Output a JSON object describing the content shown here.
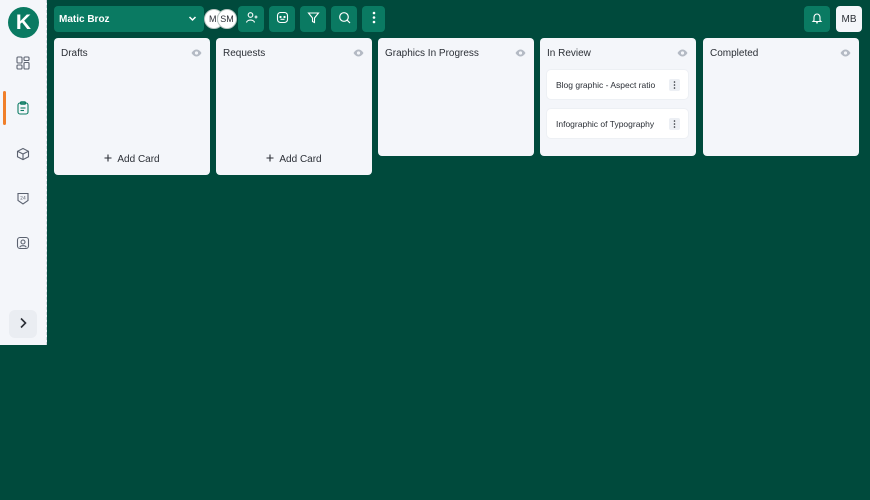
{
  "app": {
    "logo_letter": "K",
    "brand_color": "#0a7a62",
    "accent_color": "#f07f2a"
  },
  "sidebar": {
    "items": [
      {
        "icon": "dashboard-icon",
        "active": false
      },
      {
        "icon": "clipboard-icon",
        "active": true
      },
      {
        "icon": "cube-icon",
        "active": false
      },
      {
        "icon": "calendar-24-icon",
        "active": false
      },
      {
        "icon": "user-card-icon",
        "active": false
      }
    ],
    "expand_icon": "chevron-right-icon"
  },
  "topbar": {
    "project_name": "Matic Broz",
    "members": [
      "MI",
      "SM"
    ],
    "tools": [
      "add-member-icon",
      "chat-icon",
      "filter-icon",
      "search-icon",
      "more-vertical-icon"
    ],
    "notification_icon": "bell-icon",
    "current_user": "MB"
  },
  "board": {
    "columns": [
      {
        "title": "Drafts",
        "add_label": "Add Card",
        "cards": []
      },
      {
        "title": "Requests",
        "add_label": "Add Card",
        "cards": []
      },
      {
        "title": "Graphics In Progress",
        "cards": []
      },
      {
        "title": "In Review",
        "cards": [
          {
            "title": "Blog graphic - Aspect ratio"
          },
          {
            "title": "Infographic of Typography"
          }
        ]
      },
      {
        "title": "Completed",
        "cards": []
      }
    ]
  }
}
